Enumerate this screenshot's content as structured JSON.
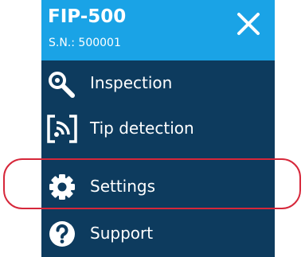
{
  "header": {
    "device_name": "FIP-500",
    "serial": "S.N.: 500001",
    "close_icon": "close-icon"
  },
  "menu": {
    "items": [
      {
        "label": "Inspection",
        "icon": "magnifier-icon"
      },
      {
        "label": "Tip detection",
        "icon": "tip-detection-icon"
      },
      {
        "label": "Settings",
        "icon": "gear-icon"
      },
      {
        "label": "Support",
        "icon": "question-icon"
      }
    ]
  },
  "colors": {
    "header_bg": "#1aa3e6",
    "menu_bg": "#0d3b5e",
    "text": "#ffffff",
    "highlight": "#d6273a"
  }
}
